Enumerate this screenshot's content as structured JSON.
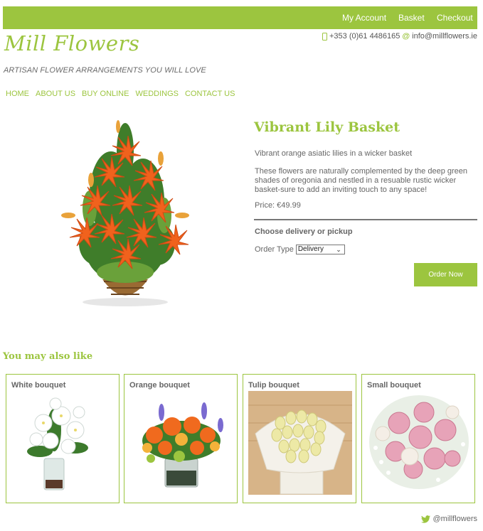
{
  "header": {
    "links": [
      "My Account",
      "Basket",
      "Checkout"
    ],
    "phone": "+353 (0)61 4486165",
    "email": "info@millflowers.ie",
    "phone_icon": "phone-icon",
    "email_icon": "at-icon"
  },
  "brand": {
    "logo": "Mill Flowers",
    "tagline": "ARTISAN FLOWER ARRANGEMENTS YOU WILL LOVE",
    "accent_color": "#9cc53f"
  },
  "nav": [
    "HOME",
    "ABOUT US",
    "BUY ONLINE",
    "WEDDINGS",
    "CONTACT US"
  ],
  "product": {
    "title": "Vibrant Lily Basket",
    "subtitle": "Vibrant orange asiatic lilies in a wicker basket",
    "description": "These flowers are naturally complemented by the deep green shades of oregonia and nestled in a resuable rustic wicker basket-sure to add an inviting touch to any space!",
    "price": "Price: €49.99",
    "choose_label": "Choose delivery or pickup",
    "order_type_label": "Order Type",
    "order_type_value": "Delivery",
    "order_button": "Order Now"
  },
  "related": {
    "heading": "You may also like",
    "items": [
      {
        "title": "White bouquet"
      },
      {
        "title": "Orange bouquet"
      },
      {
        "title": "Tulip bouquet"
      },
      {
        "title": "Small bouquet"
      }
    ]
  },
  "footer": {
    "twitter": "@millflowers",
    "twitter_icon": "twitter-icon"
  }
}
